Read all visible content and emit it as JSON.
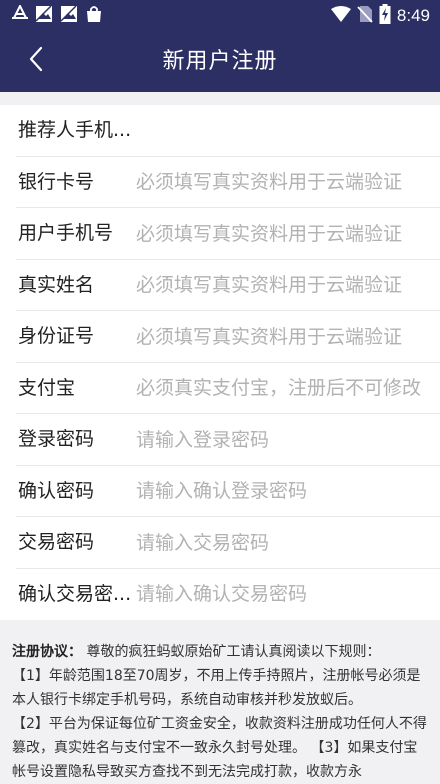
{
  "status_bar": {
    "time": "8:49",
    "left_icons": [
      "app-a-icon",
      "image-icon",
      "image-icon",
      "bag-icon"
    ],
    "right_icons": [
      "wifi-icon",
      "no-sim-icon",
      "battery-charging-icon"
    ]
  },
  "header": {
    "title": "新用户注册",
    "back_icon": "chevron-left-icon",
    "background": "#2c2f63"
  },
  "form": {
    "fields": [
      {
        "label": "推荐人手机...",
        "placeholder": "",
        "value": ""
      },
      {
        "label": "银行卡号",
        "placeholder": "必须填写真实资料用于云端验证",
        "value": ""
      },
      {
        "label": "用户手机号",
        "placeholder": "必须填写真实资料用于云端验证",
        "value": ""
      },
      {
        "label": "真实姓名",
        "placeholder": "必须填写真实资料用于云端验证",
        "value": ""
      },
      {
        "label": "身份证号",
        "placeholder": "必须填写真实资料用于云端验证",
        "value": ""
      },
      {
        "label": "支付宝",
        "placeholder": "必须真实支付宝，注册后不可修改",
        "value": ""
      },
      {
        "label": "登录密码",
        "placeholder": "请输入登录密码",
        "value": ""
      },
      {
        "label": "确认密码",
        "placeholder": "请输入确认登录密码",
        "value": ""
      },
      {
        "label": "交易密码",
        "placeholder": "请输入交易密码",
        "value": ""
      },
      {
        "label": "确认交易密...",
        "placeholder": "请输入确认交易密码",
        "value": ""
      }
    ]
  },
  "agreement": {
    "title": "注册协议：",
    "intro": " 尊敬的疯狂蚂蚁原始矿工请认真阅读以下规则：",
    "rule_1": "【1】年龄范围18至70周岁，不用上传手持照片，注册帐号必须是本人银行卡绑定手机号码，系统自动审核并秒发放蚁后。",
    "rule_2": "【2】平台为保证每位矿工资金安全，收款资料注册成功任何人不得篡改，真实姓名与支付宝不一致永久封号处理。",
    "rule_3": " 【3】如果支付宝帐号设置隐私导致买方查找不到无法完成打款，收款方永"
  }
}
